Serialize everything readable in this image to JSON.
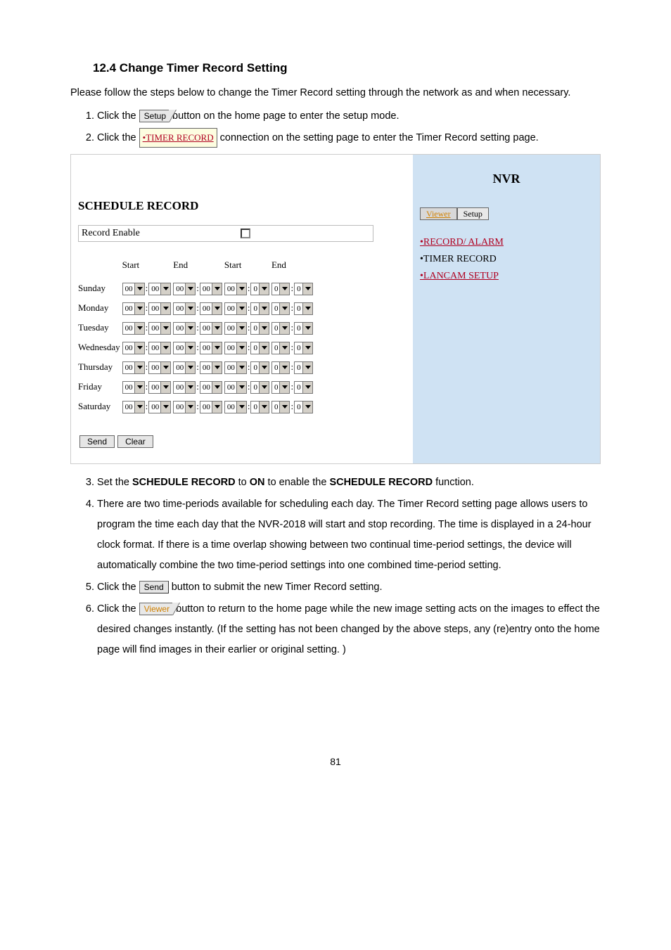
{
  "heading": "12.4 Change Timer Record Setting",
  "intro": "Please follow the steps below to change the Timer Record setting through the network as and when necessary.",
  "step1_a": "Click the ",
  "step1_btn": "Setup",
  "step1_b": " button on the home page to enter the setup mode.",
  "step2_a": "Click the ",
  "step2_link": "•TIMER RECORD",
  "step2_b": " connection on the setting page to enter the Timer Record setting page.",
  "panel": {
    "section_title": "SCHEDULE RECORD",
    "rec_enable_label": "Record Enable",
    "col_start": "Start",
    "col_end": "End",
    "days": [
      "Sunday",
      "Monday",
      "Tuesday",
      "Wednesday",
      "Thursday",
      "Friday",
      "Saturday"
    ],
    "vals": {
      "h": "00",
      "m": "00",
      "h2": "00",
      "m2": "0",
      "h3": "0",
      "m3": "0"
    },
    "send": "Send",
    "clear": "Clear",
    "nvr_title": "NVR",
    "tab_viewer": "Viewer",
    "tab_setup": "Setup",
    "link1": "•RECORD/ ALARM",
    "link2": "•TIMER RECORD",
    "link3": "•LANCAM SETUP"
  },
  "step3_a": "Set the ",
  "step3_b": "SCHEDULE RECORD",
  "step3_c": " to ",
  "step3_d": "ON",
  "step3_e": " to enable the ",
  "step3_f": "SCHEDULE RECORD",
  "step3_g": " function.",
  "step4": "There are two time-periods available for scheduling each day. The Timer Record setting page allows users to program the time each day that the NVR-2018 will start and stop recording. The time is displayed in a 24-hour clock format. If there is a time overlap showing between two continual time-period settings, the device will automatically combine the two time-period settings into one combined time-period setting.",
  "step5_a": "Click the ",
  "step5_btn": "Send",
  "step5_b": " button to submit the new Timer Record setting.",
  "step6_a": "Click the ",
  "step6_btn": "Viewer",
  "step6_b": " button to return to the home page while the new image setting acts on the      images to effect the desired changes instantly. (If the setting has not been changed by the above steps, any (re)entry onto the home page will find images in their earlier or original setting. )",
  "page_number": "81"
}
